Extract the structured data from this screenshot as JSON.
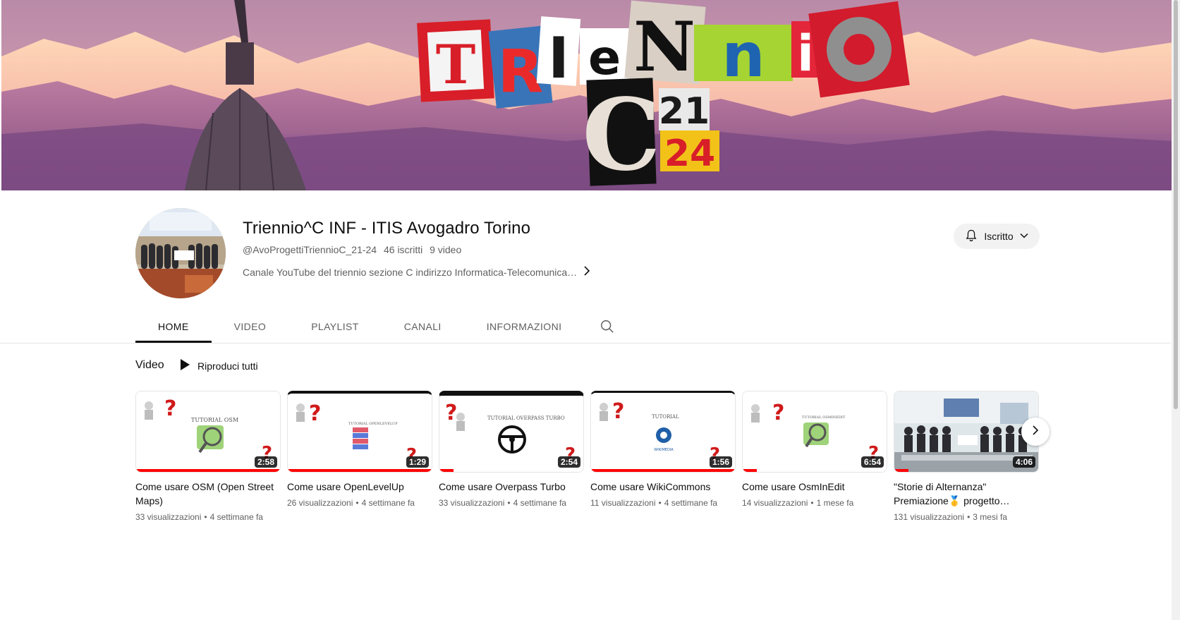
{
  "banner": {
    "letters_top": [
      "T",
      "R",
      "I",
      "e",
      "N",
      "n",
      "i",
      "O"
    ],
    "letters_bottom": [
      "C",
      "21",
      "24"
    ]
  },
  "channel": {
    "name": "Triennio^C INF - ITIS Avogadro Torino",
    "handle": "@AvoProgettiTriennioC_21-24",
    "subscribers": "46 iscritti",
    "videos_count": "9 video",
    "description": "Canale YouTube del triennio sezione C indirizzo Informatica-Telecomunica…",
    "subscribe_label": "Iscritto"
  },
  "tabs": [
    {
      "label": "HOME",
      "active": true
    },
    {
      "label": "VIDEO",
      "active": false
    },
    {
      "label": "PLAYLIST",
      "active": false
    },
    {
      "label": "CANALI",
      "active": false
    },
    {
      "label": "INFORMAZIONI",
      "active": false
    }
  ],
  "section": {
    "title": "Video",
    "play_all": "Riproduci tutti"
  },
  "videos": [
    {
      "title": "Come usare OSM (Open Street Maps)",
      "views": "33 visualizzazioni",
      "age": "4 settimane fa",
      "duration": "2:58",
      "thumb_caption": "TUTORIAL OSM",
      "watched": 1.0
    },
    {
      "title": "Come usare OpenLevelUp",
      "views": "26 visualizzazioni",
      "age": "4 settimane fa",
      "duration": "1:29",
      "thumb_caption": "TUTORIAL OPENLEVELUP",
      "watched": 1.0
    },
    {
      "title": "Come usare Overpass Turbo",
      "views": "33 visualizzazioni",
      "age": "4 settimane fa",
      "duration": "2:54",
      "thumb_caption": "TUTORIAL OVERPASS TURBO",
      "watched": 0.1
    },
    {
      "title": "Come usare WikiCommons",
      "views": "11 visualizzazioni",
      "age": "4 settimane fa",
      "duration": "1:56",
      "thumb_caption": "TUTORIAL",
      "watched": 1.0
    },
    {
      "title": "Come usare OsmInEdit",
      "views": "14 visualizzazioni",
      "age": "1 mese fa",
      "duration": "6:54",
      "thumb_caption": "TUTORIAL OSMINEDIT",
      "watched": 0.1
    },
    {
      "title": "\"Storie di Alternanza\" Premiazione🥇 progetto…",
      "views": "131 visualizzazioni",
      "age": "3 mesi fa",
      "duration": "4:06",
      "thumb_caption": "",
      "watched": 0.1
    }
  ],
  "colors": {
    "accent_red": "#ff0000",
    "text_primary": "#0f0f0f",
    "text_secondary": "#606060"
  }
}
